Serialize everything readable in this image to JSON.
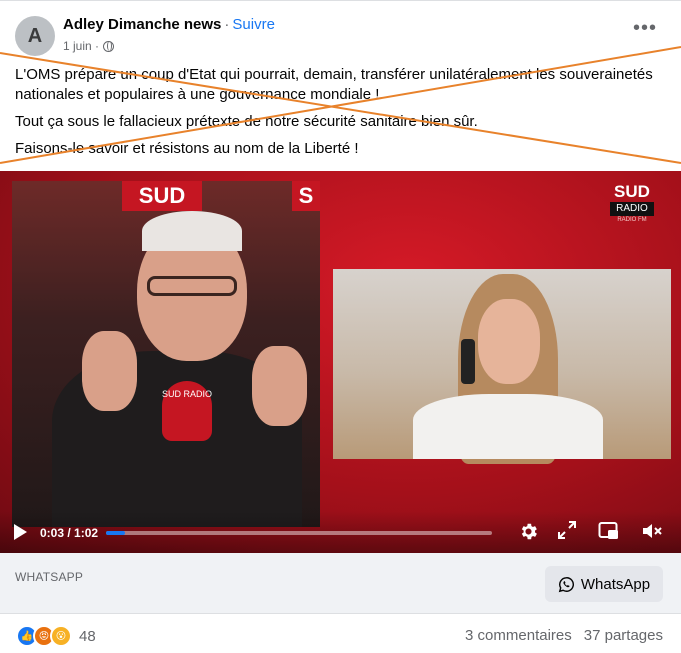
{
  "header": {
    "avatar_letter": "A",
    "page_name": "Adley Dimanche news",
    "separator": "·",
    "follow_label": "Suivre",
    "date": "1 juin ·",
    "more_label": "•••"
  },
  "post": {
    "paragraphs": [
      "L'OMS prépare un coup d'Etat qui pourrait, demain, transférer unilatéralement les souverainetés nationales et populaires à une gouvernance mondiale !",
      "Tout ça sous le fallacieux prétexte de notre sécurité sanitaire bien sûr.",
      "Faisons-le savoir et résistons au nom de la Liberté !"
    ],
    "cross_color": "#e8822b"
  },
  "video": {
    "logo_line1": "SUD",
    "logo_line2": "RADIO",
    "logo_line3": "RADIO FM",
    "studio_sign": "SUD",
    "studio_sign_right": "S",
    "mic_label": "SUD RADIO",
    "time_display": "0:03 / 1:02",
    "progress_fraction": 0.048,
    "progress_color": "#1877f2"
  },
  "link_preview": {
    "source": "WHATSAPP",
    "button_label": "WhatsApp"
  },
  "footer": {
    "reaction_count": "48",
    "comments": "3 commentaires",
    "shares": "37 partages",
    "reactions": [
      "like-icon",
      "angry-icon",
      "wow-icon"
    ]
  }
}
